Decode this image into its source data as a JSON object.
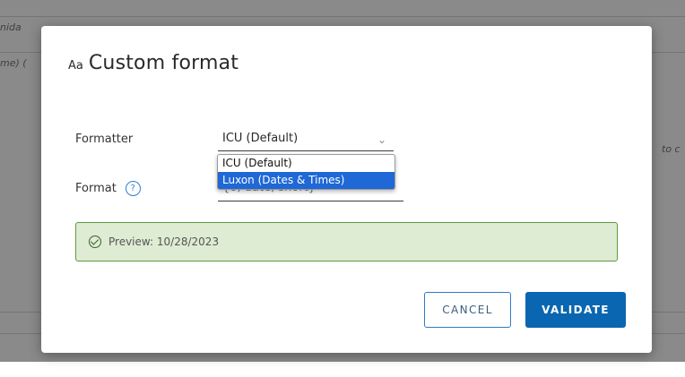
{
  "background": {
    "fragments": [
      "nida",
      "me) (",
      "to c"
    ]
  },
  "dialog": {
    "title_icon": "Aa",
    "title": "Custom format"
  },
  "form": {
    "formatter_label": "Formatter",
    "formatter_value": "ICU (Default)",
    "formatter_options": [
      "ICU (Default)",
      "Luxon (Dates & Times)"
    ],
    "selected_option_index": 1,
    "format_label": "Format",
    "format_help_icon": "question-circle-icon",
    "format_value": "{0, date, short}"
  },
  "preview": {
    "icon": "check-circle-icon",
    "text": "Preview: 10/28/2023"
  },
  "buttons": {
    "cancel": "CANCEL",
    "validate": "VALIDATE"
  },
  "colors": {
    "primary": "#0a66b0",
    "preview_bg": "#ddecd3",
    "preview_border": "#5f9a3e",
    "selection": "#1f68d6"
  }
}
